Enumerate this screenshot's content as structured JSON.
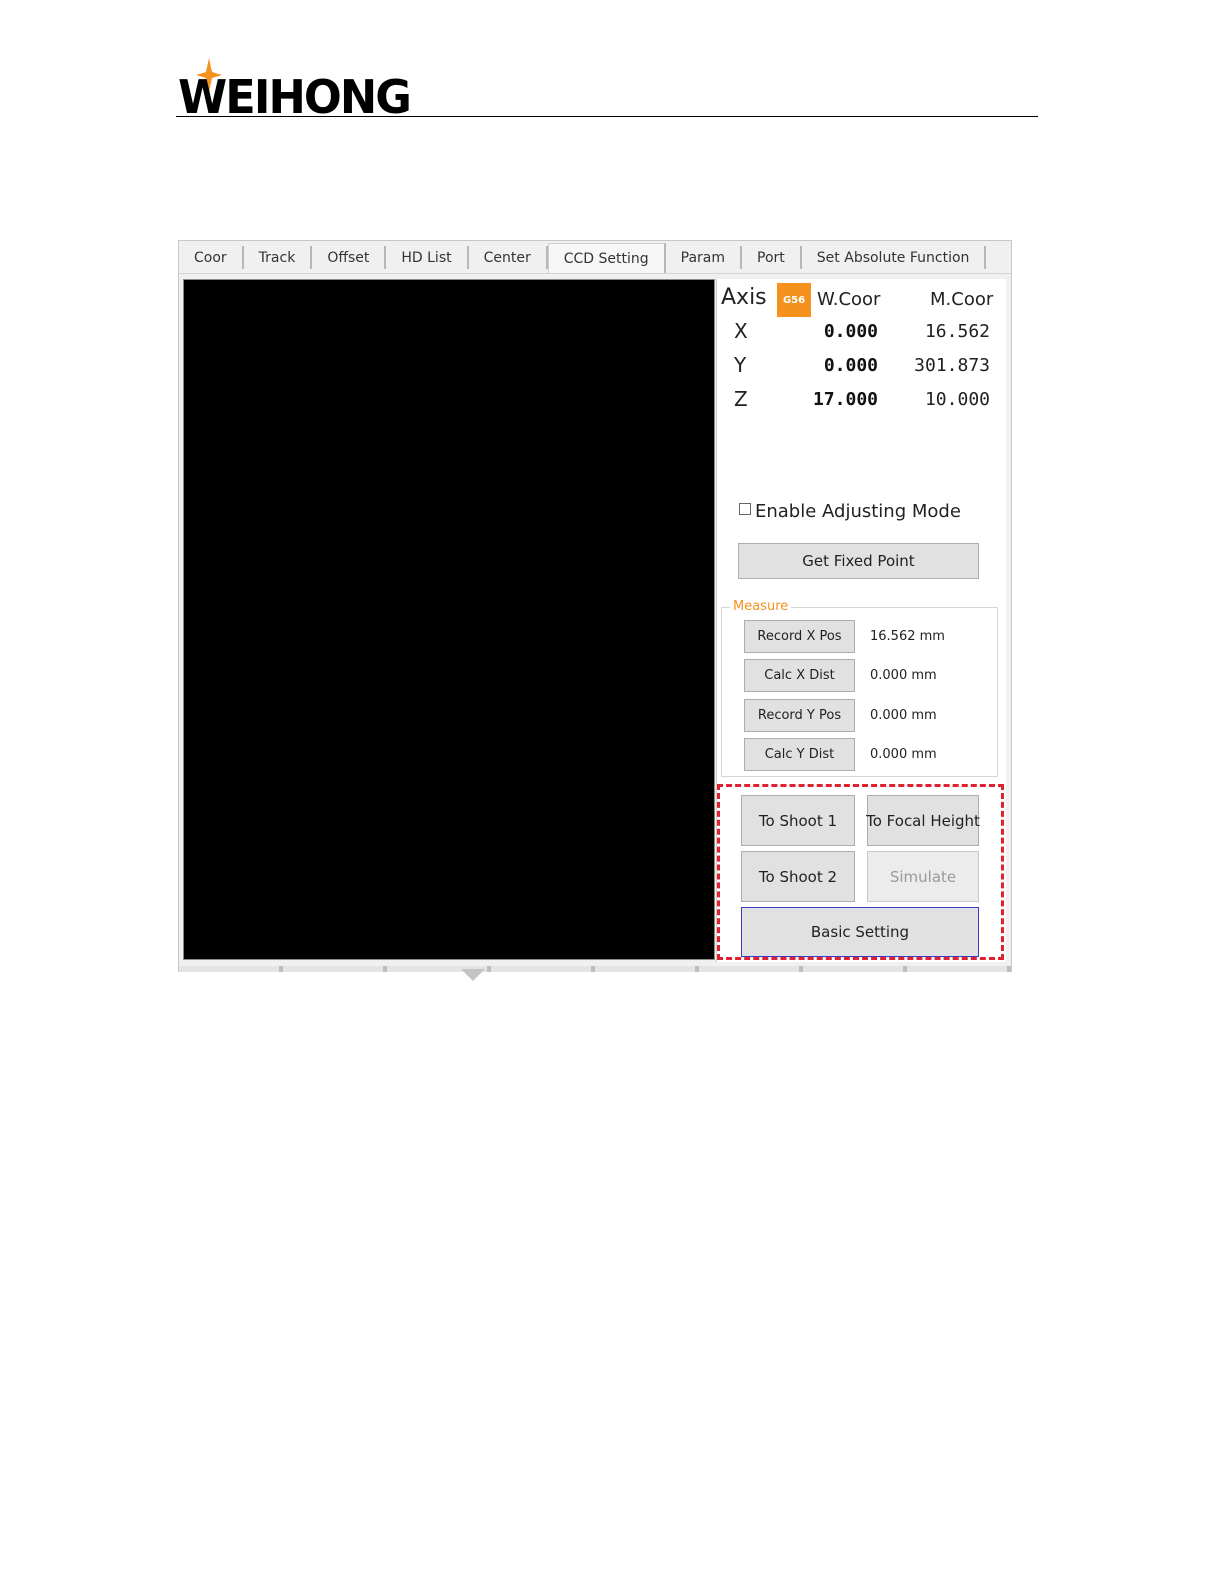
{
  "logo": {
    "brand": "WEIHONG"
  },
  "tabs": [
    {
      "label": "Coor",
      "active": false
    },
    {
      "label": "Track",
      "active": false
    },
    {
      "label": "Offset",
      "active": false
    },
    {
      "label": "HD List",
      "active": false
    },
    {
      "label": "Center",
      "active": false
    },
    {
      "label": "CCD Setting",
      "active": true
    },
    {
      "label": "Param",
      "active": false
    },
    {
      "label": "Port",
      "active": false
    },
    {
      "label": "Set Absolute Function",
      "active": false
    }
  ],
  "axis_panel": {
    "title": "Axis",
    "badge": "G56",
    "w_header": "W.Coor",
    "m_header": "M.Coor",
    "rows": [
      {
        "axis": "X",
        "w": "0.000",
        "m": "16.562"
      },
      {
        "axis": "Y",
        "w": "0.000",
        "m": "301.873"
      },
      {
        "axis": "Z",
        "w": "17.000",
        "m": "10.000"
      }
    ]
  },
  "adjust_mode": {
    "label": "Enable Adjusting Mode",
    "checked": false
  },
  "fixed_point_button": "Get Fixed Point",
  "measure": {
    "label": "Measure",
    "rows": [
      {
        "button": "Record X Pos",
        "value": "16.562 mm"
      },
      {
        "button": "Calc X Dist",
        "value": "0.000 mm"
      },
      {
        "button": "Record Y Pos",
        "value": "0.000 mm"
      },
      {
        "button": "Calc Y Dist",
        "value": "0.000 mm"
      }
    ]
  },
  "actions": {
    "to_shoot_1": "To Shoot 1",
    "to_focal_height": "To Focal Height",
    "to_shoot_2": "To Shoot 2",
    "simulate": "Simulate",
    "basic_setting": "Basic Setting"
  },
  "colors": {
    "accent_orange": "#f5921e",
    "highlight_red": "#e0212f",
    "focus_blue": "#3c3cc8"
  }
}
